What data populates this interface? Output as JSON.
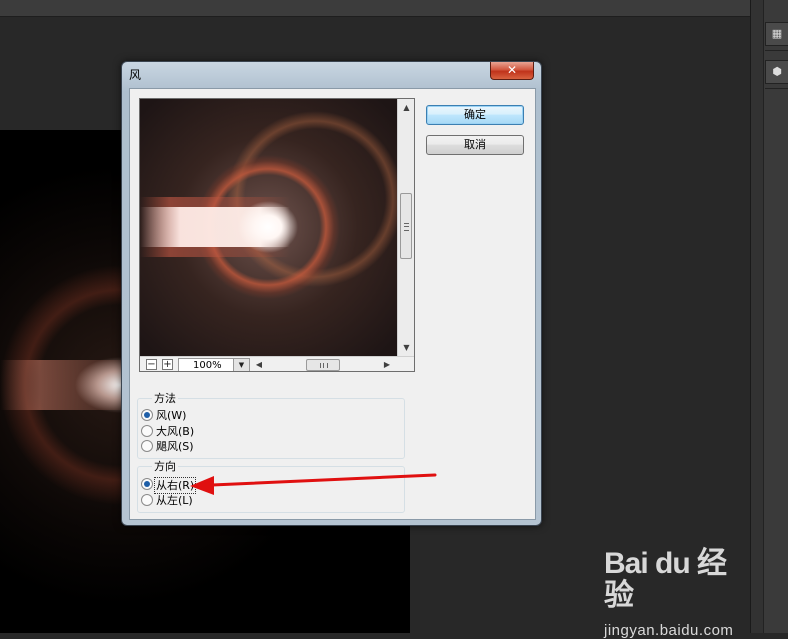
{
  "dialog": {
    "title": "风",
    "close_glyph": "✕",
    "ok_label": "确定",
    "cancel_label": "取消"
  },
  "preview": {
    "zoom_out_glyph": "−",
    "zoom_in_glyph": "+",
    "zoom_value": "100%",
    "dropdown_glyph": "▼",
    "up_arrow_glyph": "▲",
    "down_arrow_glyph": "▼",
    "left_arrow_glyph": "◀",
    "right_arrow_glyph": "▶"
  },
  "method": {
    "title": "方法",
    "options": [
      {
        "label": "风(W)",
        "checked": true
      },
      {
        "label": "大风(B)",
        "checked": false
      },
      {
        "label": "飓风(S)",
        "checked": false
      }
    ]
  },
  "direction": {
    "title": "方向",
    "options": [
      {
        "label": "从右(R)",
        "checked": true
      },
      {
        "label": "从左(L)",
        "checked": false
      }
    ]
  },
  "annotation": {
    "arrow_color": "#e01010"
  },
  "watermark": {
    "logo_text": "Bai du 经验",
    "url": "jingyan.baidu.com"
  },
  "colors": {
    "background": "#282828",
    "dialog_frame": "#b5c4d2",
    "close_button": "#c0331b",
    "default_button_border": "#3c7fb1"
  },
  "icons": {
    "close": "close-icon",
    "zoom_out": "minus-icon",
    "zoom_in": "plus-icon",
    "dropdown": "chevron-down-icon",
    "panel_icon_1": "grid-icon",
    "panel_icon_2": "cube-icon"
  },
  "panel": {
    "icon1_glyph": "▦",
    "icon2_glyph": "⬢"
  }
}
